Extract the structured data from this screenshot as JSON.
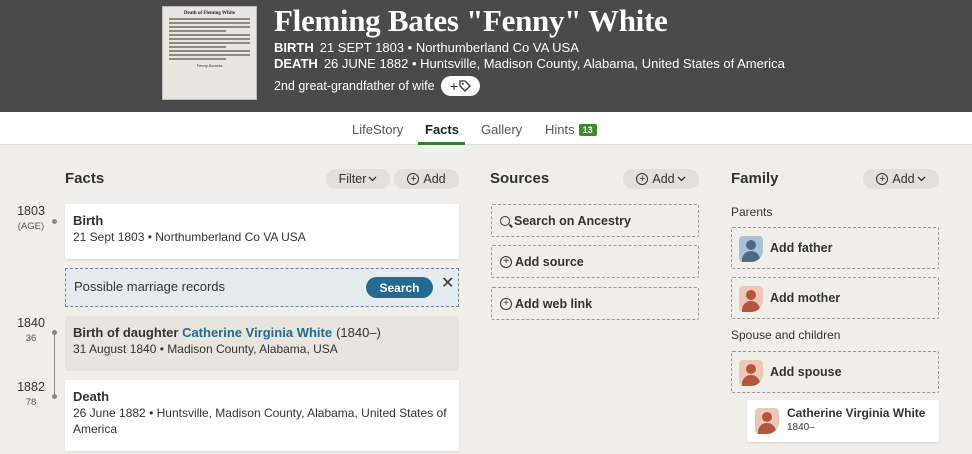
{
  "header": {
    "thumbnail": {
      "title": "Death of Fleming White",
      "signature": "Fenny Bounds"
    },
    "name": "Fleming Bates \"Fenny\" White",
    "birth_label": "BIRTH",
    "birth_value": "21 SEPT 1803 • Northumberland Co VA USA",
    "death_label": "DEATH",
    "death_value": "26 JUNE 1882 • Huntsville, Madison County, Alabama, United States of America",
    "relation": "2nd great-grandfather of wife",
    "tag_button_icon": "plus-tag-icon"
  },
  "tabs": [
    {
      "label": "LifeStory"
    },
    {
      "label": "Facts",
      "active": true
    },
    {
      "label": "Gallery"
    },
    {
      "label": "Hints",
      "badge": "13"
    }
  ],
  "facts": {
    "title": "Facts",
    "filter_label": "Filter",
    "add_label": "Add",
    "birth": {
      "year": "1803",
      "age": "(AGE)",
      "title": "Birth",
      "detail": "21 Sept 1803 • Northumberland Co VA USA"
    },
    "marriage_hint": {
      "text": "Possible marriage records",
      "search_label": "Search",
      "close": "✕"
    },
    "daughter": {
      "year": "1840",
      "age": "36",
      "prefix": "Birth of daughter",
      "name": "Catherine Virginia White",
      "range": "(1840–)",
      "detail": "31 August 1840 • Madison County, Alabama, USA"
    },
    "death": {
      "year": "1882",
      "age": "78",
      "title": "Death",
      "detail": "26 June 1882 • Huntsville, Madison County, Alabama, United States of America"
    }
  },
  "sources": {
    "title": "Sources",
    "add_label": "Add",
    "search": "Search on Ancestry",
    "add_source": "Add source",
    "add_web_link": "Add web link"
  },
  "family": {
    "title": "Family",
    "add_label": "Add",
    "parents_label": "Parents",
    "add_father": "Add father",
    "add_mother": "Add mother",
    "spouse_label": "Spouse and children",
    "add_spouse": "Add spouse",
    "child_name": "Catherine Virginia White",
    "child_range": "1840–"
  },
  "colors": {
    "header_bg": "#4a4a4a",
    "accent_green": "#2e7d32",
    "link_blue": "#256a8f",
    "badge_green": "#3d8a2d"
  }
}
